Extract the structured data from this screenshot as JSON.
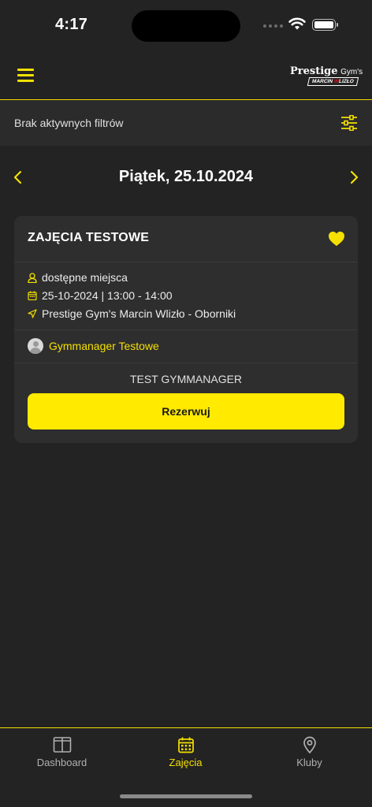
{
  "status_bar": {
    "time": "4:17"
  },
  "header": {
    "logo_brand": "Prestige",
    "logo_suffix": "Gym's",
    "logo_sub_part1": "MARCIN ",
    "logo_sub_part2": "W",
    "logo_sub_part3": "LIZŁO"
  },
  "filters": {
    "status_text": "Brak aktywnych filtrów"
  },
  "date_nav": {
    "title": "Piątek, 25.10.2024"
  },
  "class_card": {
    "title": "ZAJĘCIA TESTOWE",
    "availability": "dostępne miejsca",
    "datetime": "25-10-2024 | 13:00 - 14:00",
    "location": "Prestige Gym's Marcin Wlizło - Oborniki",
    "trainer": "Gymmanager Testowe",
    "class_name": "TEST GYMMANAGER",
    "reserve_label": "Rezerwuj"
  },
  "tab_bar": {
    "tabs": [
      {
        "label": "Dashboard",
        "icon": "dashboard-icon",
        "active": false
      },
      {
        "label": "Zajęcia",
        "icon": "calendar-icon",
        "active": true
      },
      {
        "label": "Kluby",
        "icon": "location-pin-icon",
        "active": false
      }
    ]
  },
  "colors": {
    "accent": "#f5e000",
    "button": "#ffea00",
    "background": "#232323",
    "card": "#2e2e2e"
  }
}
